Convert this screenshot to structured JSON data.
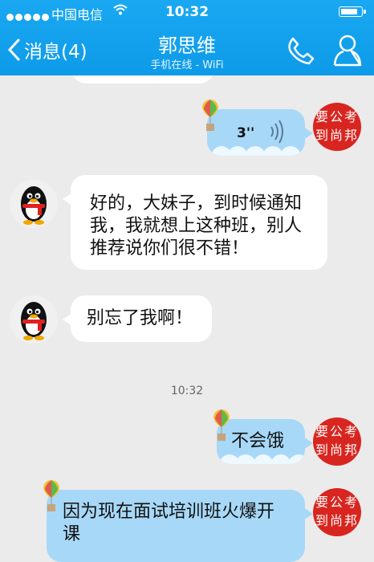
{
  "status_bar": {
    "carrier": "中国电信",
    "time": "10:32",
    "signal_dots": 5
  },
  "nav": {
    "back_label": "消息(4)",
    "contact_name": "郭思维",
    "contact_status": "手机在线 - WiFi"
  },
  "messages": [
    {
      "from": "me",
      "type": "voice",
      "duration": "3''"
    },
    {
      "from": "contact",
      "type": "text",
      "text": "好的，大妹子，到时候通知我，我就想上这种班，别人推荐说你们很不错！"
    },
    {
      "from": "contact",
      "type": "text",
      "text": "别忘了我啊！"
    },
    {
      "type": "timestamp",
      "text": "10:32"
    },
    {
      "from": "me",
      "type": "text",
      "text": "不会饿"
    },
    {
      "from": "me",
      "type": "text",
      "text": "因为现在面试培训班火爆开课"
    }
  ],
  "my_avatar_text": "要公考到尚邦",
  "colors": {
    "header": "#12a2ee",
    "outgoing_bubble": "#a7d8f7",
    "incoming_bubble": "#ffffff",
    "background": "#ebebeb",
    "seal_red": "#d9251f"
  },
  "icons": [
    "wifi-icon",
    "battery-icon",
    "back-chevron-icon",
    "phone-icon",
    "profile-icon",
    "voice-waves-icon",
    "balloon-icon",
    "qq-penguin-icon"
  ]
}
